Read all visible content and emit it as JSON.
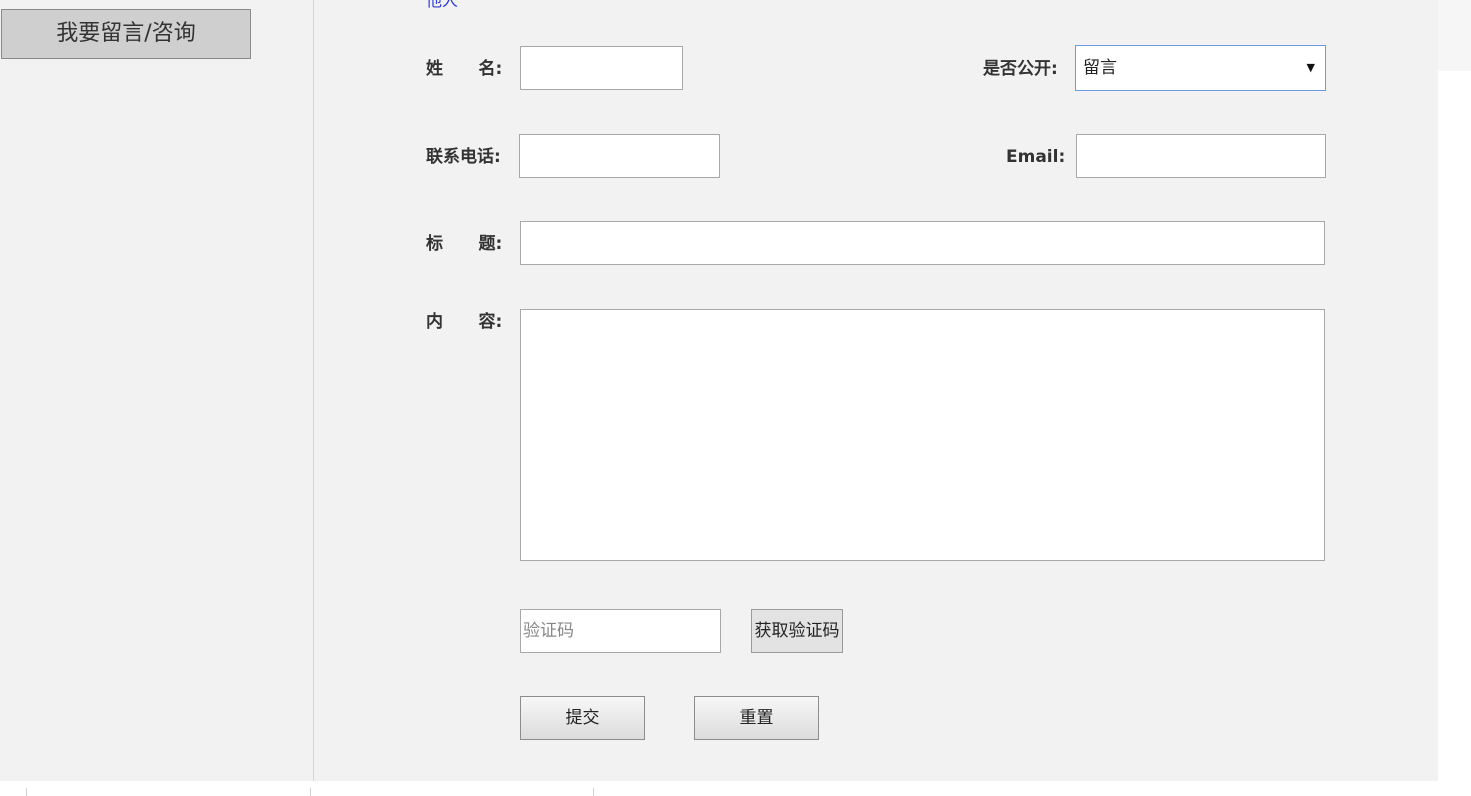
{
  "sidebar": {
    "consult_button": "我要留言/咨询"
  },
  "header": {
    "cut_link": "他人"
  },
  "form": {
    "name_label": "姓      名:",
    "public_label": "是否公开:",
    "public_selected": "留言",
    "phone_label": "联系电话:",
    "email_label": "Email:",
    "title_label": "标      题:",
    "content_label": "内      容:",
    "captcha_placeholder": "验证码",
    "get_captcha_button": "获取验证码",
    "submit_button": "提交",
    "reset_button": "重置"
  },
  "icons": {
    "dropdown_arrow": "caret-down-icon"
  }
}
